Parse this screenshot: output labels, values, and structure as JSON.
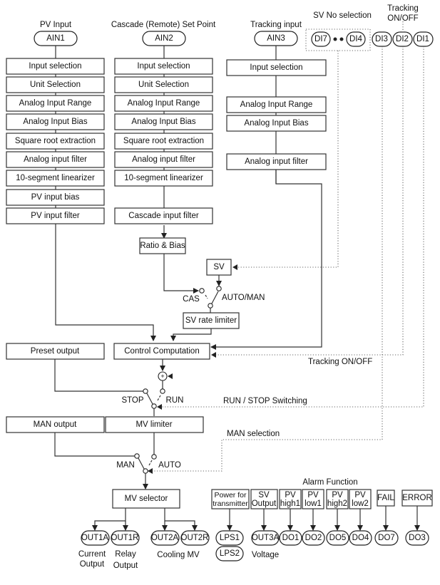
{
  "columns": {
    "pv": {
      "title": "PV Input",
      "terminal": "AIN1",
      "blocks": [
        "Input selection",
        "Unit Selection",
        "Analog Input Range",
        "Analog Input Bias",
        "Square root extraction",
        "Analog input filter",
        "10-segment linearizer",
        "PV input bias",
        "PV input filter"
      ]
    },
    "cascade": {
      "title": "Cascade (Remote) Set Point",
      "terminal": "AIN2",
      "blocks": [
        "Input selection",
        "Unit Selection",
        "Analog Input Range",
        "Analog Input Bias",
        "Square root extraction",
        "Analog input filter",
        "10-segment linearizer",
        "Cascade input filter"
      ]
    },
    "tracking": {
      "title": "Tracking input",
      "terminal": "AIN3",
      "blocks": [
        "Input selection",
        "Analog Input Range",
        "Analog Input Bias",
        "Analog input filter"
      ]
    }
  },
  "digital_inputs": {
    "sv_no_label": "SV No selection",
    "tracking_label": "Tracking ON/OFF",
    "tracking_label_line1": "Tracking",
    "tracking_label_line2": "ON/OFF",
    "terminals": [
      "DI7",
      "DI4",
      "DI3",
      "DI2",
      "DI1"
    ]
  },
  "control": {
    "ratio_bias": "Ratio & Bias",
    "sv": "SV",
    "cas_label": "CAS",
    "auto_man_label": "AUTO/MAN",
    "sv_rate_limiter": "SV rate limiter",
    "control_computation": "Control Computation",
    "preset_output": "Preset output",
    "tracking_on_off": "Tracking ON/OFF",
    "sum_symbol": "+",
    "stop_label": "STOP",
    "run_label": "RUN",
    "run_stop_switching": "RUN / STOP Switching",
    "man_output": "MAN output",
    "mv_limiter": "MV limiter",
    "man_selection": "MAN selection",
    "man_label": "MAN",
    "auto_label": "AUTO",
    "mv_selector": "MV selector"
  },
  "outputs": {
    "terminals": [
      "OUT1A",
      "OUT1R",
      "OUT2A",
      "OUT2R"
    ],
    "current_output": [
      "Current",
      "Output"
    ],
    "relay_output": [
      "Relay",
      "Output"
    ],
    "cooling_mv": "Cooling MV"
  },
  "alarm": {
    "title": "Alarm Function",
    "power_for_transmitter": [
      "Power for",
      "transmitter"
    ],
    "sv_output": [
      "SV",
      "Output"
    ],
    "pv_high1": [
      "PV",
      "high1"
    ],
    "pv_low1": [
      "PV",
      "low1"
    ],
    "pv_high2": [
      "PV",
      "high2"
    ],
    "pv_low2": [
      "PV",
      "low2"
    ],
    "fail": "FAIL",
    "error": "ERROR",
    "terminals": {
      "lps1": "LPS1",
      "lps2": "LPS2",
      "out3a": "OUT3A",
      "do1": "DO1",
      "do2": "DO2",
      "do5": "DO5",
      "do4": "DO4",
      "do7": "DO7",
      "do3": "DO3"
    },
    "voltage": "Voltage"
  }
}
